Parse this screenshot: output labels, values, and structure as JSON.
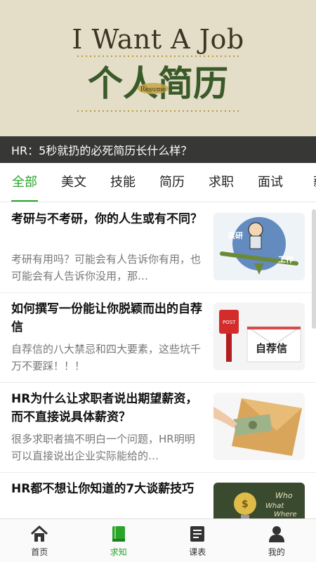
{
  "banner": {
    "heading": "I Want A Job",
    "art_title": "个人简历",
    "art_badge": "Resume",
    "caption": "HR：5秒就扔的必死简历长什么样？"
  },
  "tabs": [
    {
      "label": "全部",
      "active": true
    },
    {
      "label": "美文",
      "active": false
    },
    {
      "label": "技能",
      "active": false
    },
    {
      "label": "简历",
      "active": false
    },
    {
      "label": "求职",
      "active": false
    },
    {
      "label": "面试",
      "active": false
    },
    {
      "label": "薪",
      "active": false
    }
  ],
  "articles": [
    {
      "title": "考研与不考研，你的人生或有不同？",
      "summary": "考研有用吗？可能会有人告诉你有用，也可能会有人告诉你没用，那…",
      "thumb_icon": "seesaw-illustration",
      "thumb_labels": [
        "读研",
        "工作"
      ]
    },
    {
      "title": "如何撰写一份能让你脱颖而出的自荐信",
      "summary": "自荐信的八大禁忌和四大要素，这些坑千万不要踩！！！",
      "thumb_icon": "mailbox-illustration",
      "thumb_labels": [
        "POST",
        "自荐信"
      ]
    },
    {
      "title": "HR为什么让求职者说出期望薪资，而不直接说具体薪资？",
      "summary": "很多求职者搞不明白一个问题，HR明明可以直接说出企业实际能给的…",
      "thumb_icon": "salary-envelope-illustration",
      "thumb_labels": []
    },
    {
      "title": "HR都不想让你知道的7大谈薪技巧",
      "summary": "",
      "thumb_icon": "lightbulb-illustration",
      "thumb_labels": [
        "Who",
        "What",
        "Where"
      ]
    }
  ],
  "nav": [
    {
      "label": "首页",
      "icon": "home-icon",
      "active": false
    },
    {
      "label": "求知",
      "icon": "book-icon",
      "active": true
    },
    {
      "label": "课表",
      "icon": "schedule-icon",
      "active": false
    },
    {
      "label": "我的",
      "icon": "user-icon",
      "active": false
    }
  ],
  "colors": {
    "accent": "#2aa52a",
    "caption_bar": "#2a2a2a",
    "banner_bg": "#e9e3cf"
  }
}
